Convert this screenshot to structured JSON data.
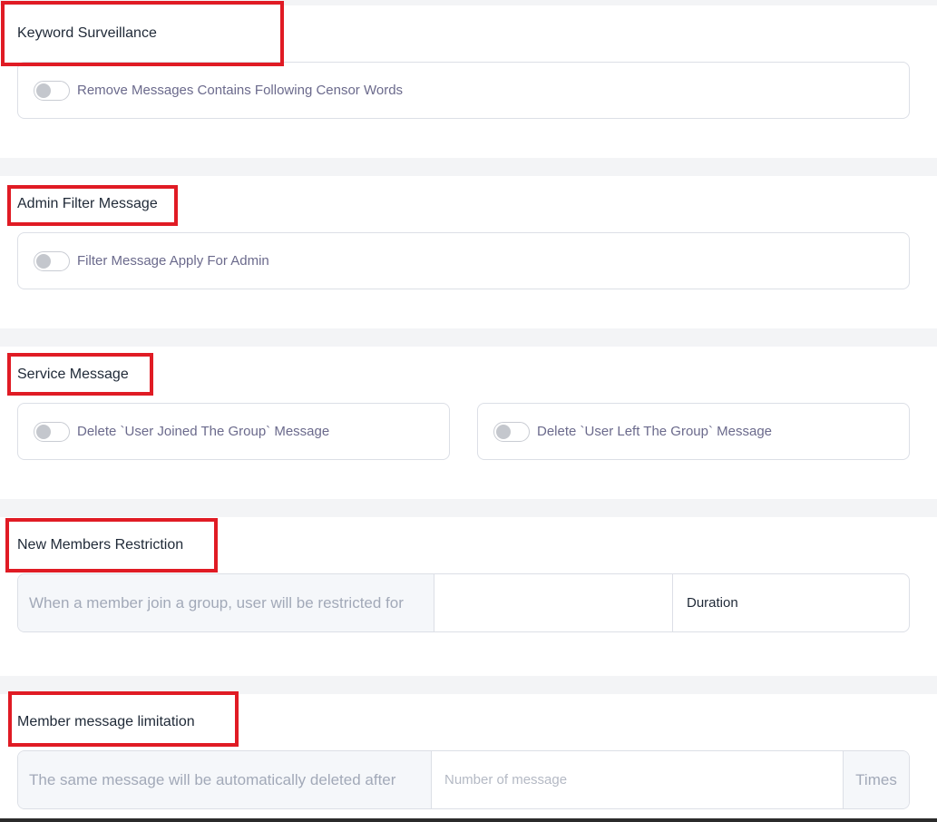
{
  "sections": {
    "keyword": {
      "title": "Keyword Surveillance",
      "toggle_label": "Remove Messages Contains Following Censor Words"
    },
    "admin_filter": {
      "title": "Admin Filter Message",
      "toggle_label": "Filter Message Apply For Admin"
    },
    "service": {
      "title": "Service Message",
      "joined_label": "Delete `User Joined The Group` Message",
      "left_label": "Delete `User Left The Group` Message"
    },
    "new_members": {
      "title": "New Members Restriction",
      "prefix": "When a member join a group, user will be restricted for",
      "value": "",
      "duration_label": "Duration"
    },
    "message_limit": {
      "title": "Member message limitation",
      "prefix": "The same message will be automatically deleted after",
      "placeholder": "Number of message",
      "suffix": "Times"
    }
  },
  "colors": {
    "highlight": "#e01b24",
    "toggle_off": "#c4c7cd",
    "label_text": "#6b6a8c"
  }
}
